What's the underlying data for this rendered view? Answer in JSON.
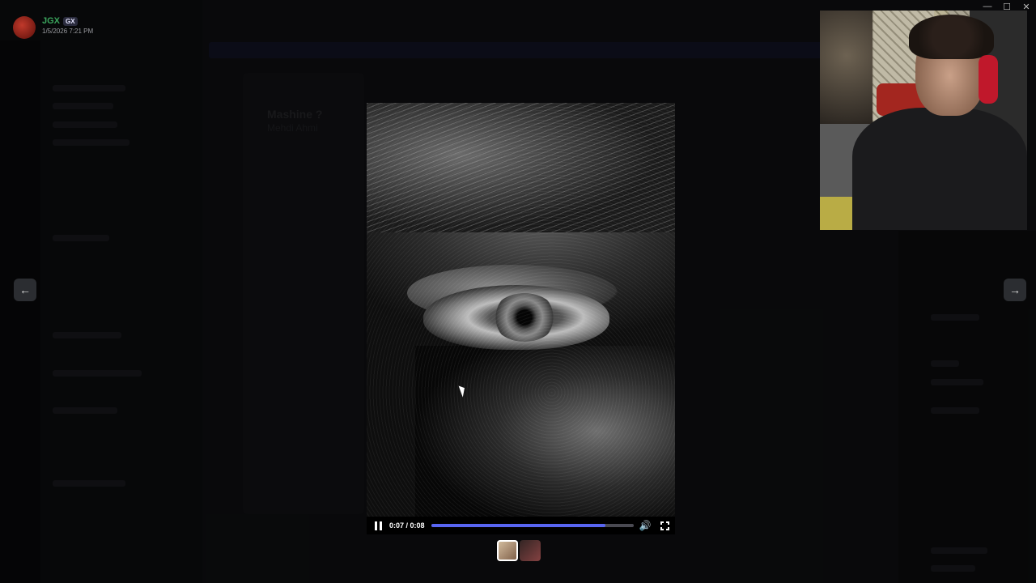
{
  "user": {
    "name": "JGX",
    "tag": "GX",
    "timestamp": "1/5/2026 7:21 PM"
  },
  "window": {
    "title": "",
    "minimize": "—",
    "maximize": "☐",
    "close": "✕"
  },
  "background": {
    "card_title": "Mashine ?",
    "card_sub": "Mehdi Ahmi"
  },
  "player": {
    "time": "0:07 / 0:08",
    "progress": 0.86,
    "accent_color": "#5865f2",
    "playing": true
  },
  "nav": {
    "prev": "←",
    "next": "→"
  },
  "icons": {
    "pause": "pause-icon",
    "volume": "volume-icon",
    "fullscreen": "fullscreen-icon"
  },
  "thumbnails": [
    {
      "selected": true
    },
    {
      "selected": false
    }
  ]
}
